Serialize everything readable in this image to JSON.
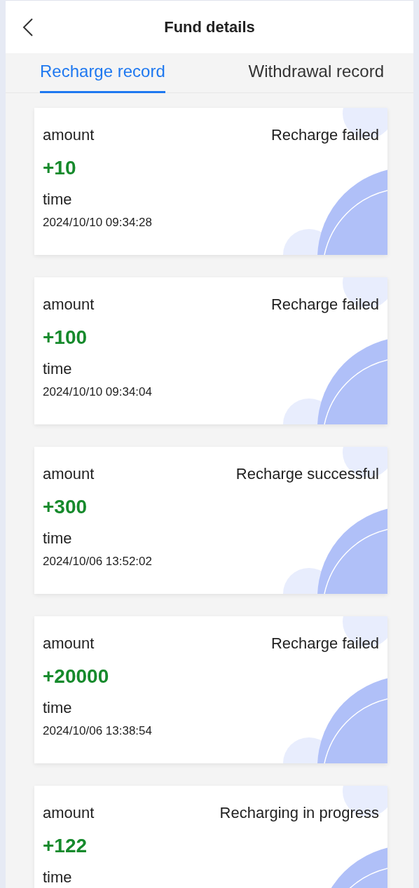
{
  "header": {
    "title": "Fund details"
  },
  "tabs": [
    {
      "label": "Recharge record",
      "selected": true
    },
    {
      "label": "Withdrawal record",
      "selected": false
    }
  ],
  "records": [
    {
      "amount_label": "amount",
      "status": "Recharge failed",
      "amount": "+10",
      "time_label": "time",
      "time": "2024/10/10 09:34:28"
    },
    {
      "amount_label": "amount",
      "status": "Recharge failed",
      "amount": "+100",
      "time_label": "time",
      "time": "2024/10/10 09:34:04"
    },
    {
      "amount_label": "amount",
      "status": "Recharge successful",
      "amount": "+300",
      "time_label": "time",
      "time": "2024/10/06 13:52:02"
    },
    {
      "amount_label": "amount",
      "status": "Recharge failed",
      "amount": "+20000",
      "time_label": "time",
      "time": "2024/10/06 13:38:54"
    },
    {
      "amount_label": "amount",
      "status": "Recharging in progress",
      "amount": "+122",
      "time_label": "time"
    }
  ]
}
